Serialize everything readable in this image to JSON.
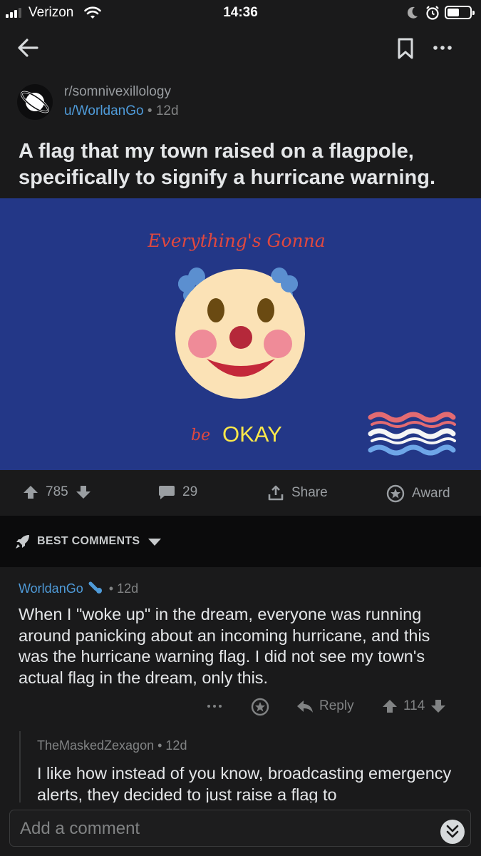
{
  "status": {
    "carrier": "Verizon",
    "time": "14:36"
  },
  "post": {
    "subreddit": "r/somnivexillology",
    "author": "u/WorldanGo",
    "age": "12d",
    "title": "A flag that my town raised on a flagpole, specifically to signify a hurricane warning.",
    "image": {
      "top_text": "Everything's Gonna",
      "bottom_prefix": "be",
      "bottom_main": "OKAY",
      "background": "#233787"
    }
  },
  "actions": {
    "upvotes": "785",
    "comments": "29",
    "share": "Share",
    "award": "Award"
  },
  "sort": {
    "label": "BEST COMMENTS"
  },
  "comments": [
    {
      "author": "WorldanGo",
      "age": "12d",
      "body": "When I \"woke up\" in the dream, everyone was running around panicking about an incoming hurricane, and this was the hurricane warning flag. I did not see my town's actual flag in the dream, only this.",
      "reply_label": "Reply",
      "score": "114"
    },
    {
      "author": "TheMaskedZexagon",
      "age": "12d",
      "body": "I like how instead of you know, broadcasting emergency alerts, they decided to just raise a flag to"
    }
  ],
  "comment_input": {
    "placeholder": "Add a comment"
  },
  "colors": {
    "accent": "#4f9bd9",
    "background": "#1a1a1b",
    "flag_blue": "#233787"
  }
}
